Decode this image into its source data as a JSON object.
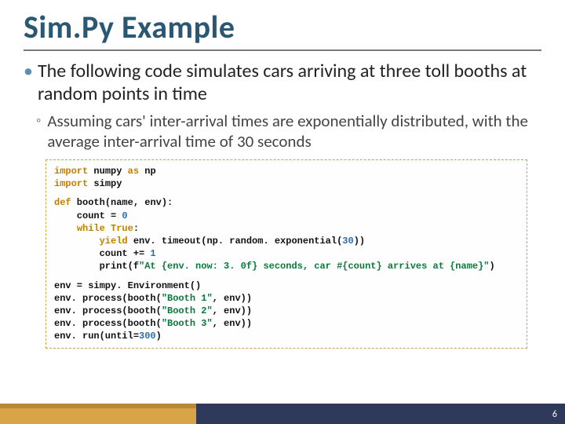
{
  "title": "Sim.Py Example",
  "bullet1": "The following code simulates cars arriving at three toll booths at random points in time",
  "bullet2": "Assuming cars' inter-arrival times are exponentially distributed, with the average inter-arrival time of 30 seconds",
  "code": {
    "l1a": "import",
    "l1b": " numpy ",
    "l1c": "as",
    "l1d": " np",
    "l2a": "import",
    "l2b": " simpy",
    "l3a": "def",
    "l3b": " booth",
    "l3c": "(name, env):",
    "l4a": "    count = ",
    "l4b": "0",
    "l5a": "    ",
    "l5b": "while True",
    "l5c": ":",
    "l6a": "        ",
    "l6b": "yield",
    "l6c": " env. timeout(np. random. exponential(",
    "l6d": "30",
    "l6e": "))",
    "l7a": "        count += ",
    "l7b": "1",
    "l8a": "        print(f",
    "l8b": "\"At {env. now: 3. 0f} seconds, car #{count} arrives at {name}\"",
    "l8c": ")",
    "l9a": "env = simpy. Environment()",
    "l10a": "env. process(booth(",
    "l10b": "\"Booth 1\"",
    "l10c": ", env))",
    "l11a": "env. process(booth(",
    "l11b": "\"Booth 2\"",
    "l11c": ", env))",
    "l12a": "env. process(booth(",
    "l12b": "\"Booth 3\"",
    "l12c": ", env))",
    "l13a": "env. run(until=",
    "l13b": "300",
    "l13c": ")"
  },
  "page_number": "6"
}
